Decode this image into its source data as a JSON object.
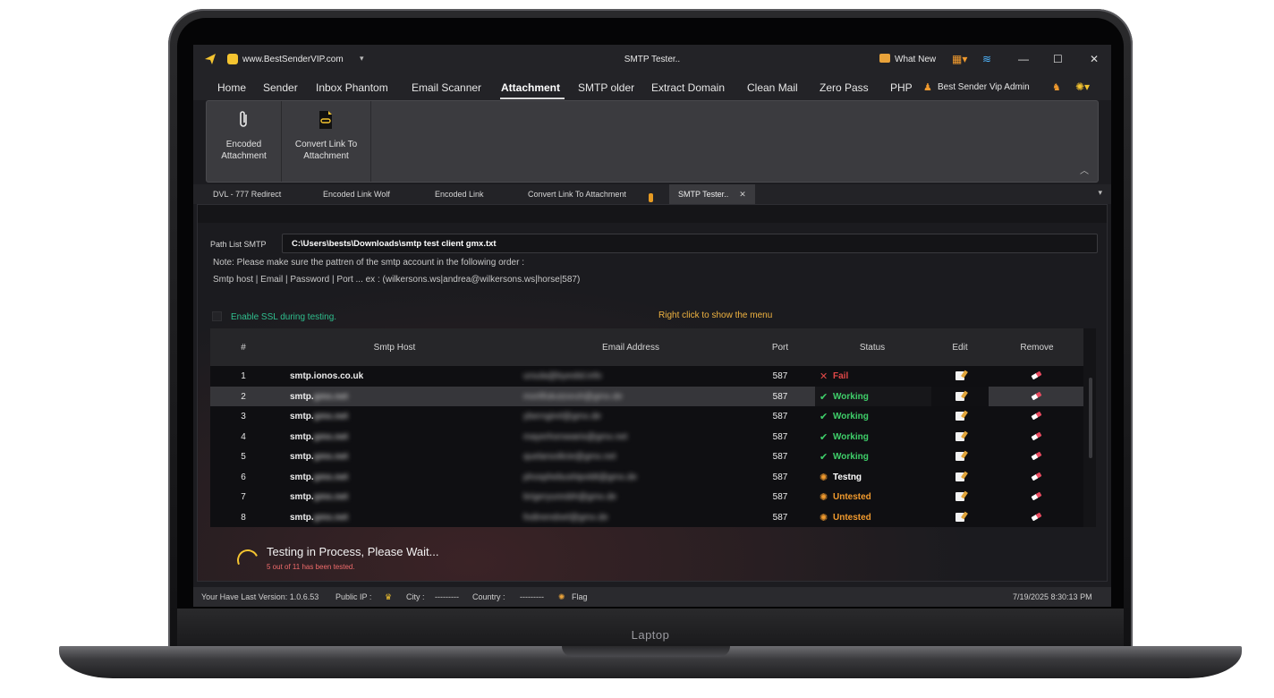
{
  "device": {
    "label": "Laptop"
  },
  "window": {
    "site": "www.BestSenderVIP.com",
    "title": "SMTP Tester..",
    "whats_new": "What New"
  },
  "menu": {
    "items": [
      "Home",
      "Sender",
      "Inbox Phantom",
      "Email Scanner",
      "Attachment",
      "SMTP older",
      "Extract Domain",
      "Clean Mail",
      "Zero Pass",
      "PHP"
    ],
    "active": "Attachment",
    "user": "Best Sender Vip Admin"
  },
  "ribbon": {
    "buttons": [
      {
        "label": "Encoded Attachment",
        "icon": "paperclip-icon"
      },
      {
        "label": "Convert Link To Attachment",
        "icon": "link-file-icon"
      }
    ]
  },
  "doc_tabs": {
    "tabs": [
      "DVL - 777 Redirect",
      "Encoded Link Wolf",
      "Encoded Link",
      "Convert Link To Attachment",
      "SMTP Tester.."
    ],
    "active": "SMTP Tester.."
  },
  "form": {
    "path_label": "Path List SMTP",
    "path_value": "C:\\Users\\bests\\Downloads\\smtp test client gmx.txt",
    "note1": "Note: Please make sure the pattren of the smtp account in the following order :",
    "note2": "Smtp host | Email | Password | Port ... ex : (wilkersons.ws|andrea@wilkersons.ws|horse|587)",
    "ssl_label": "Enable SSL during testing.",
    "right_click_hint": "Right click to show the menu"
  },
  "table": {
    "columns": [
      "#",
      "Smtp Host",
      "Email Address",
      "Port",
      "Status",
      "Edit",
      "Remove"
    ],
    "rows": [
      {
        "num": "1",
        "host_visible": "smtp.ionos.co.uk",
        "host_blur": "",
        "email": "ursula@byeslid.info",
        "port": "587",
        "status": "Fail",
        "status_icon": "x-icon"
      },
      {
        "num": "2",
        "host_visible": "smtp.",
        "host_blur": "gmx.net",
        "email": "morlifukutzsruh@gmx.de",
        "port": "587",
        "status": "Working",
        "status_icon": "check-icon"
      },
      {
        "num": "3",
        "host_visible": "smtp.",
        "host_blur": "gmx.net",
        "email": "yberngirel@gmx.de",
        "port": "587",
        "status": "Working",
        "status_icon": "check-icon"
      },
      {
        "num": "4",
        "host_visible": "smtp.",
        "host_blur": "gmx.net",
        "email": "mayerhorswaris@gmx.net",
        "port": "587",
        "status": "Working",
        "status_icon": "check-icon"
      },
      {
        "num": "5",
        "host_visible": "smtp.",
        "host_blur": "gmx.net",
        "email": "quelarsoilicie@gmx.net",
        "port": "587",
        "status": "Working",
        "status_icon": "check-icon"
      },
      {
        "num": "6",
        "host_visible": "smtp.",
        "host_blur": "gmx.net",
        "email": "phosphebushipoldt@gmx.de",
        "port": "587",
        "status": "Testng",
        "status_icon": "spark-icon"
      },
      {
        "num": "7",
        "host_visible": "smtp.",
        "host_blur": "gmx.net",
        "email": "brigeryuresbh@gmx.de",
        "port": "587",
        "status": "Untested",
        "status_icon": "spark-icon"
      },
      {
        "num": "8",
        "host_visible": "smtp.",
        "host_blur": "gmx.net",
        "email": "fodinendoel@gmx.de",
        "port": "587",
        "status": "Untested",
        "status_icon": "spark-icon"
      }
    ],
    "selected_row": 2
  },
  "progress": {
    "title": "Testing in Process, Please Wait...",
    "subtitle": "5 out of 11 has been tested."
  },
  "statusbar": {
    "version": "Your Have Last Version: 1.0.6.53",
    "public_ip_label": "Public IP :",
    "city_label": "City :",
    "city_value": "---------",
    "country_label": "Country :",
    "country_value": "---------",
    "flag_label": "Flag",
    "datetime": "7/19/2025 8:30:13 PM"
  },
  "colors": {
    "fail": "#e04848",
    "working": "#3fcf6a",
    "untested": "#f09a2e",
    "accent": "#f4c430"
  }
}
